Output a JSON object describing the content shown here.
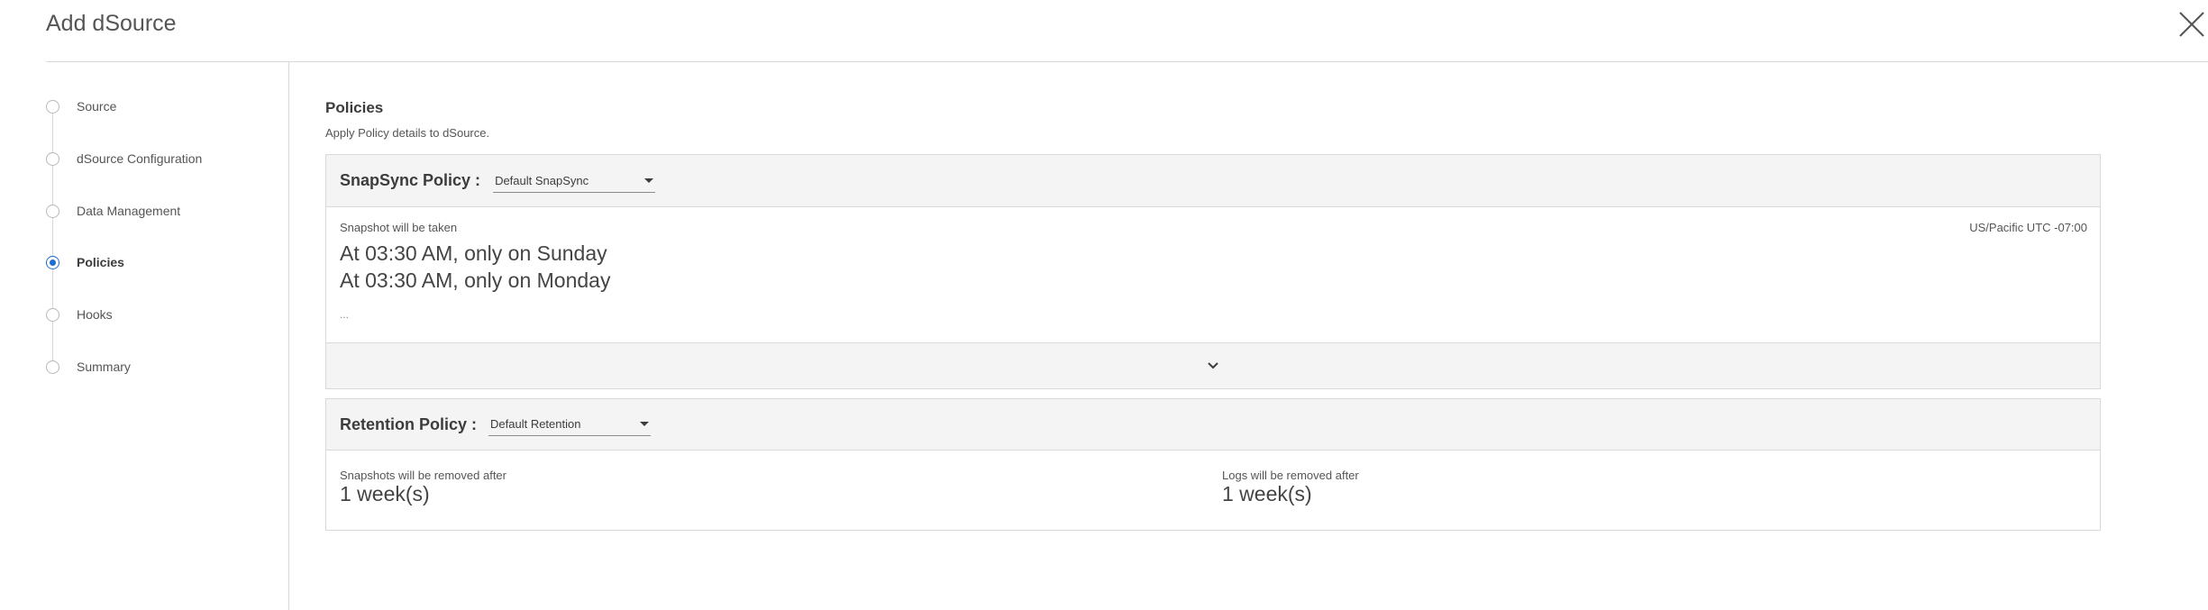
{
  "dialog": {
    "title": "Add dSource",
    "close_icon": "close-icon"
  },
  "stepper": {
    "steps": [
      {
        "label": "Source",
        "active": false
      },
      {
        "label": "dSource Configuration",
        "active": false
      },
      {
        "label": "Data Management",
        "active": false
      },
      {
        "label": "Policies",
        "active": true
      },
      {
        "label": "Hooks",
        "active": false
      },
      {
        "label": "Summary",
        "active": false
      }
    ]
  },
  "policies": {
    "title": "Policies",
    "subtitle": "Apply Policy details to dSource.",
    "snapsync": {
      "label": "SnapSync Policy :",
      "selected": "Default SnapSync",
      "schedule_label": "Snapshot will be taken",
      "timezone": "US/Pacific UTC -07:00",
      "schedule": [
        "At 03:30 AM, only on Sunday",
        "At 03:30 AM, only on Monday"
      ],
      "more": "...",
      "expand_icon": "chevron-down-icon"
    },
    "retention": {
      "label": "Retention Policy :",
      "selected": "Default Retention",
      "snapshots_label": "Snapshots will be removed after",
      "snapshots_value": "1 week(s)",
      "logs_label": "Logs will be removed after",
      "logs_value": "1 week(s)"
    }
  },
  "colors": {
    "accent": "#1f6ccf",
    "panel_header_bg": "#f4f4f4",
    "border": "#d9d9d9"
  }
}
